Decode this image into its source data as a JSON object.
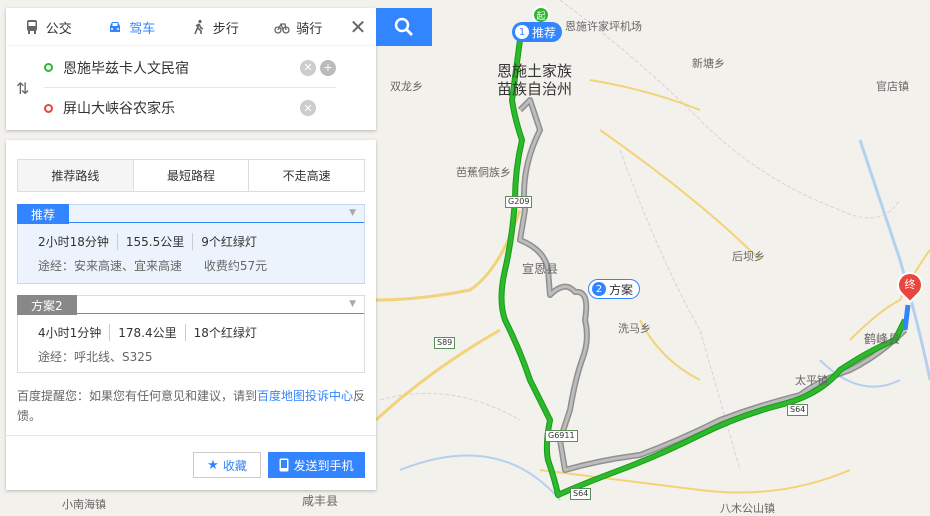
{
  "modes": [
    {
      "label": "公交",
      "icon": "bus-icon"
    },
    {
      "label": "驾车",
      "icon": "car-icon"
    },
    {
      "label": "步行",
      "icon": "walk-icon"
    },
    {
      "label": "骑行",
      "icon": "bike-icon"
    }
  ],
  "active_mode": "驾车",
  "inputs": {
    "start": "恩施毕兹卡人文民宿",
    "end": "屏山大峡谷农家乐"
  },
  "tabs": [
    "推荐路线",
    "最短路程",
    "不走高速"
  ],
  "routes": [
    {
      "tag": "推荐",
      "time": "2小时18分钟",
      "distance": "155.5公里",
      "lights": "9个红绿灯",
      "via_label": "途经：安来高速、宜来高速",
      "toll": "收费约57元"
    },
    {
      "tag": "方案2",
      "time": "4小时1分钟",
      "distance": "178.4公里",
      "lights": "18个红绿灯",
      "via_label": "途经：呼北线、S325",
      "toll": ""
    }
  ],
  "notice": {
    "prefix": "百度提醒您：如果您有任何意见和建议，请到",
    "link": "百度地图投诉中心",
    "suffix": "反馈。"
  },
  "buttons": {
    "favorite": "收藏",
    "send": "发送到手机"
  },
  "map": {
    "city_line1": "恩施土家族",
    "city_line2": "苗族自治州",
    "labels": {
      "airport": "恩施许家坪机场",
      "shuanglong": "双龙乡",
      "xintang": "新塘乡",
      "guandian": "官店镇",
      "bajiao": "芭蕉侗族乡",
      "xuanen": "宣恩县",
      "houba": "后坝乡",
      "xima": "洗马乡",
      "hefeng": "鹤峰县",
      "taiping": "太平镇",
      "xiaonanhai": "小南海镇",
      "xianfeng": "咸丰县",
      "bamu": "八木公山镇"
    },
    "shields": {
      "g209": "G209",
      "s89": "S89",
      "g6911": "G6911",
      "s64a": "S64",
      "s64b": "S64"
    },
    "markers": {
      "rec": "推荐",
      "plan": "方案",
      "rec_num": "1",
      "plan_num": "2",
      "start": "起",
      "end": "终"
    }
  },
  "colors": {
    "accent": "#3385ff",
    "route_main": "#2db82d",
    "route_alt": "#9a9a9a",
    "rec_tag": "#3385ff",
    "alt_tag": "#888888",
    "end_marker": "#e8463e"
  }
}
